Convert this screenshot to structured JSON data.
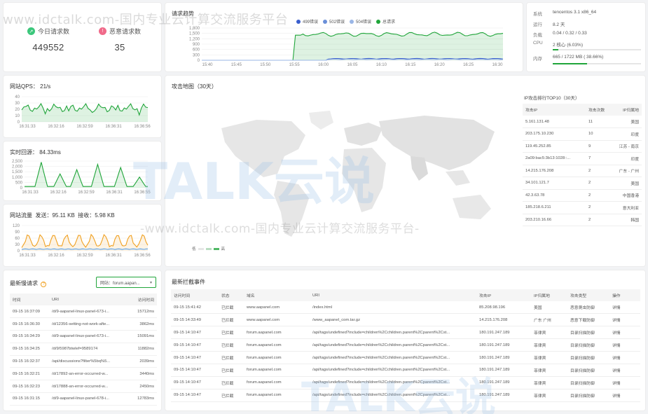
{
  "today_requests": {
    "label": "今日请求数",
    "value": "449552"
  },
  "malicious_requests": {
    "label": "恶意请求数",
    "value": "35"
  },
  "trend": {
    "title": "请求趋势",
    "legend": [
      {
        "name": "499错误",
        "color": "#3a5fcd"
      },
      {
        "name": "502错误",
        "color": "#6a8fd8"
      },
      {
        "name": "504错误",
        "color": "#9ab6e6"
      },
      {
        "name": "总请求",
        "color": "#20a53a"
      }
    ],
    "yticks": [
      "1,800",
      "1,500",
      "1,200",
      "900",
      "600",
      "300",
      "0"
    ],
    "xticks": [
      "15:40",
      "15:45",
      "15:50",
      "15:55",
      "16:00",
      "16:05",
      "16:10",
      "16:15",
      "16:20",
      "16:25",
      "16:30"
    ]
  },
  "system": {
    "rows": [
      {
        "k": "系统",
        "v": "tencentos 3.1 x86_64"
      },
      {
        "k": "运行",
        "v": "8.2 天"
      },
      {
        "k": "负载",
        "v": "0.04 / 0.32 / 0.33"
      },
      {
        "k": "CPU",
        "v": "2 核心 (6.03%)"
      },
      {
        "k": "内存",
        "v": "665 / 1722 MB ( 38.66%)"
      }
    ],
    "cpu_percent": 6.03,
    "mem_percent": 38.66
  },
  "qps": {
    "title": "网站QPS： 21/s",
    "yticks": [
      "40",
      "30",
      "20",
      "10",
      "0"
    ],
    "xticks": [
      "16:31:33",
      "16:32:16",
      "16:32:59",
      "16:36:31",
      "16:36:56"
    ]
  },
  "response": {
    "title": "实时回源： 84.33ms",
    "yticks": [
      "2,500",
      "2,000",
      "1,500",
      "1,000",
      "500",
      "0"
    ],
    "xticks": [
      "16:31:33",
      "16:32:16",
      "16:32:59",
      "16:36:31",
      "16:36:55"
    ]
  },
  "traffic": {
    "title": "网站流量",
    "send_label": "发送：",
    "send_value": "95.11 KB",
    "recv_label": "接收：",
    "recv_value": "5.98 KB",
    "yticks": [
      "120",
      "90",
      "60",
      "30",
      "0"
    ],
    "xticks": [
      "16:31:33",
      "16:32:16",
      "16:32:59",
      "16:36:31",
      "16:36:56"
    ]
  },
  "map": {
    "title": "攻击地图（30天）",
    "legend_low": "低",
    "legend_high": "高"
  },
  "ip_top": {
    "title": "IP攻击排行TOP10（30天）",
    "headers": [
      "攻击IP",
      "攻击次数",
      "IP归属地"
    ],
    "rows": [
      [
        "5.161.131.48",
        "11",
        "美国"
      ],
      [
        "203.175.10.230",
        "10",
        "印度"
      ],
      [
        "119.45.252.85",
        "9",
        "江苏 - 南京"
      ],
      [
        "2a09:bac5:3b13:1028::...",
        "7",
        "印度"
      ],
      [
        "14.215.176.208",
        "2",
        "广东 - 广州"
      ],
      [
        "34.101.121.7",
        "2",
        "美国"
      ],
      [
        "42.3.63.78",
        "2",
        "中国香港"
      ],
      [
        "185.218.6.211",
        "2",
        "意大利亚"
      ],
      [
        "203.210.16.66",
        "2",
        "韩国"
      ]
    ]
  },
  "slow": {
    "title": "最新慢请求",
    "select_value": "网站：forum.aapan...",
    "headers": [
      "时间",
      "URI",
      "访问时间"
    ],
    "rows": [
      [
        "09-15 16:37:09",
        "/d/9-aapanel-linux-panel-673-i...",
        "15712ms"
      ],
      [
        "09-15 16:36:30",
        "/d/12356-setting-not-work-afte...",
        "3862ms"
      ],
      [
        "09-15 16:34:29",
        "/d/9-aapanel-linux-panel-673-i...",
        "15091ms"
      ],
      [
        "09-15 16:34:25",
        "/d/9/5987btwlef=9589174",
        "11882ms"
      ],
      [
        "09-15 16:32:37",
        "/api/discussions?filter%5bq%5...",
        "2039ms"
      ],
      [
        "09-15 16:32:21",
        "/d/17892-an-error-occurred-w...",
        "3440ms"
      ],
      [
        "09-15 16:32:23",
        "/d/17888-an-error-occurred-w...",
        "2450ms"
      ],
      [
        "09-15 16:31:15",
        "/d/9-aapanel-linux-panel-678-i...",
        "12783ms"
      ]
    ]
  },
  "events": {
    "title": "最新拦截事件",
    "headers": [
      "访问时间",
      "状态",
      "域名",
      "URI",
      "攻击IP",
      "IP归属地",
      "攻击类型",
      "操作"
    ],
    "rows": [
      [
        "09-15 15:41:42",
        "已拦截",
        "www.aapanel.com",
        "/index.html",
        "85.208.98.196",
        "美国",
        "恶意爬虫防御",
        "详情"
      ],
      [
        "09-15 14:33:49",
        "已拦截",
        "www.aapanel.com",
        "/www_aapanel_com.tar.gz",
        "14.215.176.208",
        "广东 广州",
        "恶意下载防御",
        "详情"
      ],
      [
        "09-15 14:10:47",
        "已拦截",
        "forum.aapanel.com",
        "/api/tags/undefined?include=children%2Cchildren.parent%2Cparent%2Cst...",
        "180.191.247.189",
        "菲律宾",
        "目录扫描防御",
        "详情"
      ],
      [
        "09-15 14:10:47",
        "已拦截",
        "forum.aapanel.com",
        "/api/tags/undefined?include=children%2Cchildren.parent%2Cparent%2Cst...",
        "180.191.247.189",
        "菲律宾",
        "目录扫描防御",
        "详情"
      ],
      [
        "09-15 14:10:47",
        "已拦截",
        "forum.aapanel.com",
        "/api/tags/undefined?include=children%2Cchildren.parent%2Cparent%2Cst...",
        "180.191.247.189",
        "菲律宾",
        "目录扫描防御",
        "详情"
      ],
      [
        "09-15 14:10:47",
        "已拦截",
        "forum.aapanel.com",
        "/api/tags/undefined?include=children%2Cchildren.parent%2Cparent%2Cst...",
        "180.191.247.189",
        "菲律宾",
        "目录扫描防御",
        "详情"
      ],
      [
        "09-15 14:10:47",
        "已拦截",
        "forum.aapanel.com",
        "/api/tags/undefined?include=children%2Cchildren.parent%2Cparent%2Cst...",
        "180.191.247.189",
        "菲律宾",
        "目录扫描防御",
        "详情"
      ],
      [
        "09-15 14:10:47",
        "已拦截",
        "forum.aapanel.com",
        "/api/tags/undefined?include=children%2Cchildren.parent%2Cparent%2Cst...",
        "180.191.247.189",
        "菲律宾",
        "目录扫描防御",
        "详情"
      ]
    ]
  },
  "watermark": {
    "top": "www.idctalk.com-国内专业云计算交流服务平台",
    "mid": "-www.idctalk.com-国内专业云计算交流服务平台-",
    "logo": "TALK云说",
    "logo_corner": "TALK云说"
  }
}
